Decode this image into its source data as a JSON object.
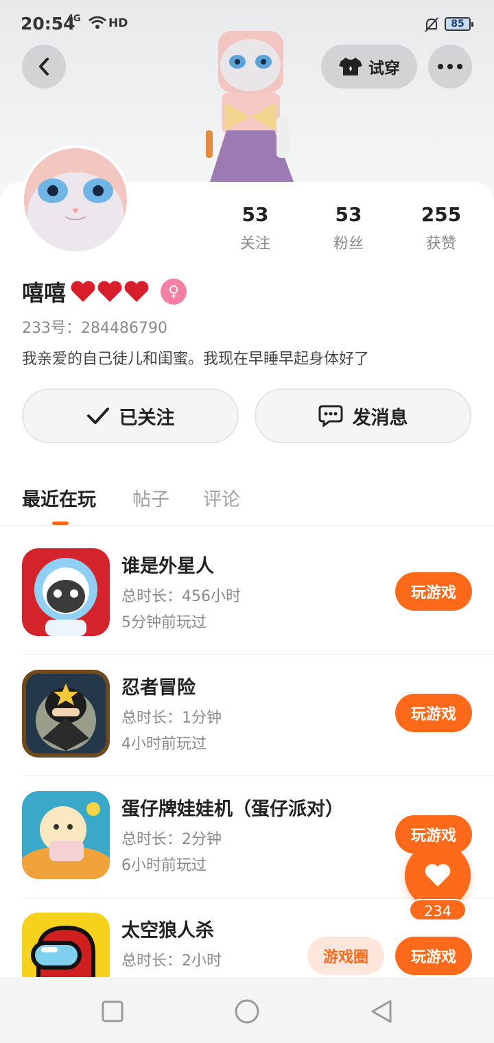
{
  "status_bar": {
    "time": "20:54",
    "network": "4G",
    "hd": "HD",
    "battery": "85"
  },
  "header": {
    "try_on_label": "试穿"
  },
  "profile": {
    "stats": [
      {
        "value": "53",
        "label": "关注"
      },
      {
        "value": "53",
        "label": "粉丝"
      },
      {
        "value": "255",
        "label": "获赞"
      }
    ],
    "name": "嘻嘻",
    "name_emoji": "❤️❤️❤️",
    "gender": "female",
    "uid": "233号：284486790",
    "bio": "我亲爱的自己徒儿和闺蜜。我现在早睡早起身体好了",
    "follow_label": "已关注",
    "message_label": "发消息"
  },
  "tabs": [
    {
      "label": "最近在玩",
      "active": true
    },
    {
      "label": "帖子",
      "active": false
    },
    {
      "label": "评论",
      "active": false
    }
  ],
  "games": [
    {
      "title": "谁是外星人",
      "duration": "总时长：456小时",
      "last_played": "5分钟前玩过",
      "play_label": "玩游戏"
    },
    {
      "title": "忍者冒险",
      "duration": "总时长：1分钟",
      "last_played": "4小时前玩过",
      "play_label": "玩游戏"
    },
    {
      "title": "蛋仔牌娃娃机（蛋仔派对）",
      "duration": "总时长：2分钟",
      "last_played": "6小时前玩过",
      "play_label": "玩游戏"
    },
    {
      "title": "太空狼人杀",
      "duration": "总时长：2小时",
      "last_played": "",
      "play_label": "玩游戏",
      "circle_label": "游戏圈"
    }
  ],
  "like": {
    "count": "234"
  },
  "colors": {
    "accent": "#ff6a1a",
    "accent_soft": "#fde7dc",
    "gender_female": "#f47fa2"
  }
}
